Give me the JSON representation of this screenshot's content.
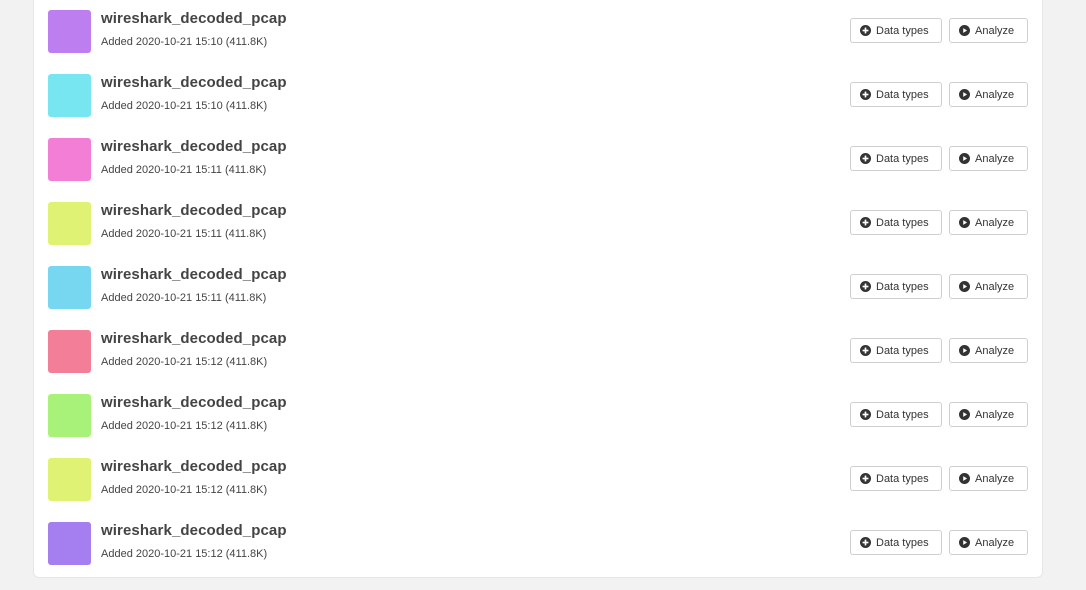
{
  "colors": {
    "page_background": "#f2f2f2",
    "panel_background": "#ffffff",
    "button_border": "#cfcfcf",
    "text": "#444444"
  },
  "actions": {
    "data_types_label": "Data types",
    "data_types_icon": "plus-circle-icon",
    "analyze_label": "Analyze",
    "analyze_icon": "play-circle-icon"
  },
  "items": [
    {
      "name": "wireshark_decoded_pcap",
      "added": "Added 2020-10-21 15:10 (411.8K)",
      "color": "#bd7ef0"
    },
    {
      "name": "wireshark_decoded_pcap",
      "added": "Added 2020-10-21 15:10 (411.8K)",
      "color": "#77e6f0"
    },
    {
      "name": "wireshark_decoded_pcap",
      "added": "Added 2020-10-21 15:11 (411.8K)",
      "color": "#f27ed6"
    },
    {
      "name": "wireshark_decoded_pcap",
      "added": "Added 2020-10-21 15:11 (411.8K)",
      "color": "#e0f274"
    },
    {
      "name": "wireshark_decoded_pcap",
      "added": "Added 2020-10-21 15:11 (411.8K)",
      "color": "#77d7f0"
    },
    {
      "name": "wireshark_decoded_pcap",
      "added": "Added 2020-10-21 15:12 (411.8K)",
      "color": "#f27e98"
    },
    {
      "name": "wireshark_decoded_pcap",
      "added": "Added 2020-10-21 15:12 (411.8K)",
      "color": "#a8f27a"
    },
    {
      "name": "wireshark_decoded_pcap",
      "added": "Added 2020-10-21 15:12 (411.8K)",
      "color": "#e0f274"
    },
    {
      "name": "wireshark_decoded_pcap",
      "added": "Added 2020-10-21 15:12 (411.8K)",
      "color": "#a57ef0"
    }
  ]
}
